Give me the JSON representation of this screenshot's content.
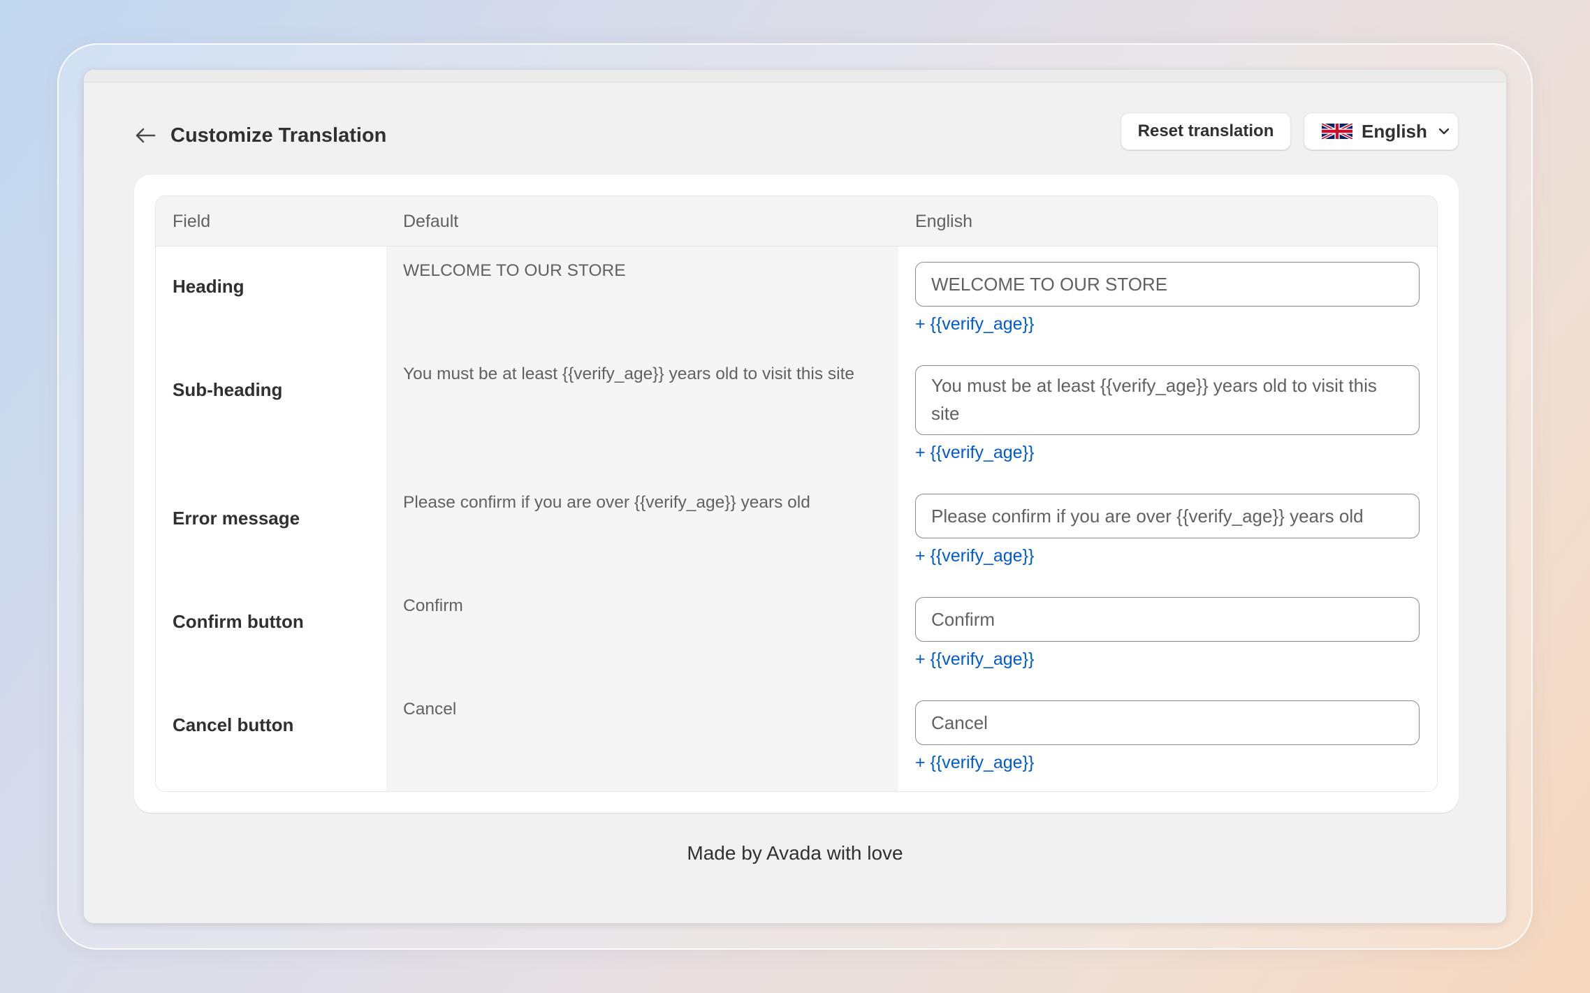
{
  "header": {
    "title": "Customize Translation",
    "reset_label": "Reset translation",
    "language": {
      "label": "English",
      "flag_icon": "uk-flag-icon"
    }
  },
  "table": {
    "columns": {
      "field": "Field",
      "default": "Default",
      "translation": "English"
    },
    "rows": [
      {
        "field": "Heading",
        "default": "WELCOME TO OUR STORE",
        "value": "WELCOME TO OUR STORE",
        "token": "+ {{verify_age}}"
      },
      {
        "field": "Sub-heading",
        "default": "You must be at least {{verify_age}} years old to visit this site",
        "value": "You must be at least {{verify_age}} years old to visit this site",
        "token": "+ {{verify_age}}"
      },
      {
        "field": "Error message",
        "default": "Please confirm if you are over {{verify_age}} years old",
        "value": "Please confirm if you are over {{verify_age}} years old",
        "token": "+ {{verify_age}}"
      },
      {
        "field": "Confirm button",
        "default": "Confirm",
        "value": "Confirm",
        "token": "+ {{verify_age}}"
      },
      {
        "field": "Cancel button",
        "default": "Cancel",
        "value": "Cancel",
        "token": "+ {{verify_age}}"
      }
    ]
  },
  "footer": {
    "text": "Made by Avada with love"
  },
  "colors": {
    "link": "#005bd3",
    "text_primary": "#303030",
    "text_secondary": "#616161"
  }
}
